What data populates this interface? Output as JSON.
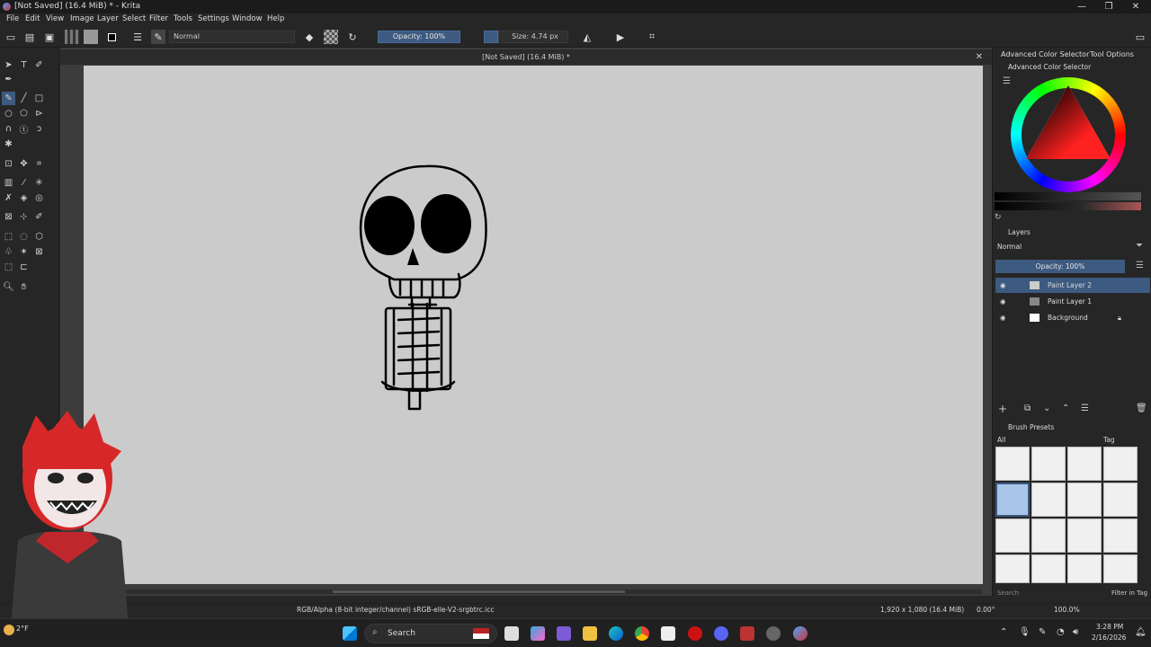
{
  "window": {
    "title": "[Not Saved]  (16.4 MiB) * - Krita",
    "controls": {
      "minimize": "—",
      "maximize": "❐",
      "close": "✕"
    }
  },
  "menu": [
    "File",
    "Edit",
    "View",
    "Image",
    "Layer",
    "Select",
    "Filter",
    "Tools",
    "Settings",
    "Window",
    "Help"
  ],
  "toolbar": {
    "blend_mode": "Normal",
    "opacity": "Opacity: 100%",
    "size": "Size: 4.74 px"
  },
  "document": {
    "tab_title": "[Not Saved]  (16.4 MiB) *",
    "close": "✕"
  },
  "dock": {
    "tabs": [
      "Advanced Color Selector",
      "Tool Options"
    ],
    "color_panel_title": "Advanced Color Selector",
    "layers_title": "Layers",
    "layers_blend": "Normal",
    "layers_opacity": "Opacity:  100%",
    "layers": [
      {
        "name": "Paint Layer 2",
        "selected": true
      },
      {
        "name": "Paint Layer 1",
        "selected": false
      },
      {
        "name": "Background",
        "selected": false,
        "locked": true
      }
    ],
    "brush_title": "Brush Presets",
    "brush_filter": "All",
    "brush_tag": "Tag",
    "brush_search_placeholder": "Search",
    "filter_in_tag": "Filter in Tag"
  },
  "status": {
    "color_info": "RGB/Alpha (8-bit integer/channel)  sRGB-elle-V2-srgbtrc.icc",
    "dimensions": "1,920 x 1,080 (16.4 MiB)",
    "rotation": "0.00°",
    "zoom": "100.0%"
  },
  "taskbar": {
    "search": "Search",
    "time": "3:28 PM",
    "date": "2/16/2026",
    "weather": "2°F"
  },
  "colors": {
    "accent": "#3d5a80",
    "canvas": "#cbcbcb",
    "selected_layer": "#3d5a80"
  }
}
